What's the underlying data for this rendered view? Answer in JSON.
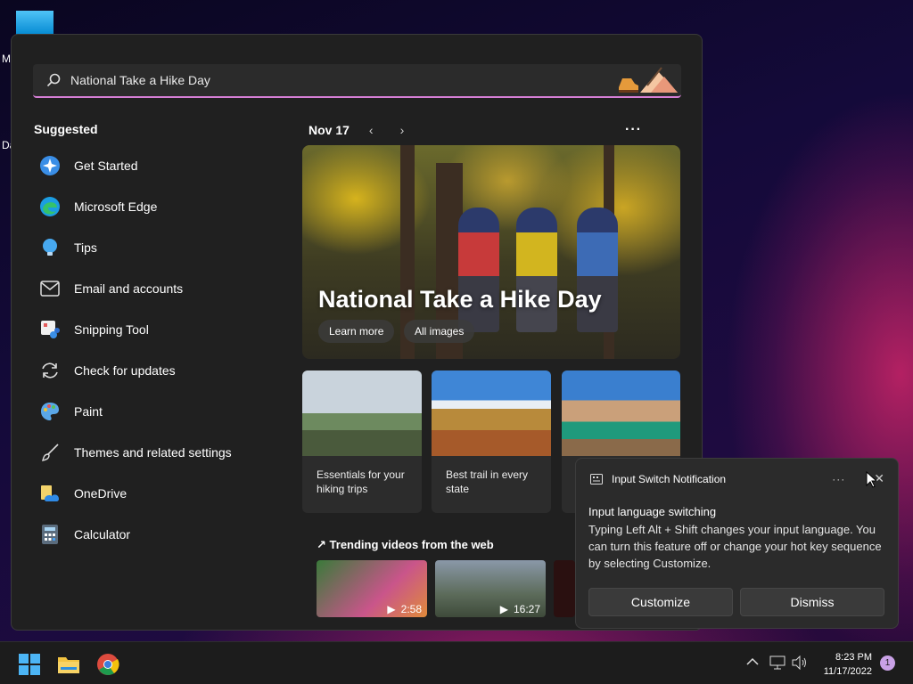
{
  "desktop": {
    "labels": [
      "M",
      "Da"
    ]
  },
  "search": {
    "value": "National Take a Hike Day"
  },
  "suggested": {
    "title": "Suggested",
    "items": [
      {
        "label": "Get Started",
        "icon": "get-started-icon"
      },
      {
        "label": "Microsoft Edge",
        "icon": "edge-icon"
      },
      {
        "label": "Tips",
        "icon": "tips-icon"
      },
      {
        "label": "Email and accounts",
        "icon": "mail-icon"
      },
      {
        "label": "Snipping Tool",
        "icon": "snipping-tool-icon"
      },
      {
        "label": "Check for updates",
        "icon": "refresh-icon"
      },
      {
        "label": "Paint",
        "icon": "paint-icon"
      },
      {
        "label": "Themes and related settings",
        "icon": "brush-icon"
      },
      {
        "label": "OneDrive",
        "icon": "onedrive-icon"
      },
      {
        "label": "Calculator",
        "icon": "calculator-icon"
      }
    ]
  },
  "highlights": {
    "date": "Nov 17",
    "prev": "‹",
    "next": "›",
    "more": "···",
    "hero": {
      "title": "National Take a Hike Day",
      "learn_more": "Learn more",
      "all_images": "All images"
    },
    "cards": [
      {
        "caption": "Essentials for your hiking trips"
      },
      {
        "caption": "Best trail in every state"
      },
      {
        "caption": ""
      }
    ],
    "trending": {
      "title": "Trending videos from the web",
      "videos": [
        {
          "duration": "2:58"
        },
        {
          "duration": "16:27"
        }
      ]
    }
  },
  "notification": {
    "app": "Input Switch Notification",
    "more": "···",
    "close": "✕",
    "title": "Input language switching",
    "body": "Typing Left Alt + Shift changes your input language. You can turn this feature off or change your hot key sequence by selecting Customize.",
    "customize": "Customize",
    "dismiss": "Dismiss"
  },
  "taskbar": {
    "time": "8:23 PM",
    "date": "11/17/2022",
    "badge": "1",
    "chevron": "^"
  },
  "colors": {
    "accent": "#d67fd6",
    "panel": "#202020",
    "notification_bg": "#2b2b2b"
  }
}
